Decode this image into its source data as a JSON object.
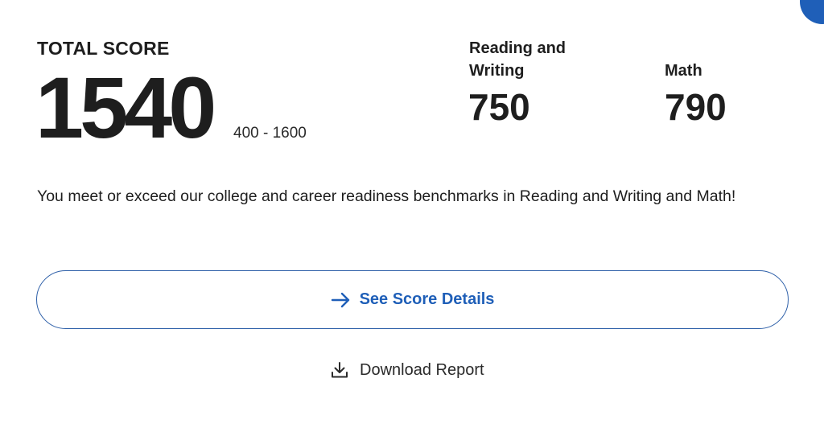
{
  "colors": {
    "accent": "#1f5fb8",
    "text": "#1e1e1e",
    "button_border": "#2d5fa8"
  },
  "total": {
    "label": "TOTAL SCORE",
    "value": "1540",
    "range": "400 - 1600"
  },
  "sections": {
    "reading_writing": {
      "label": "Reading and Writing",
      "value": "750"
    },
    "math": {
      "label": "Math",
      "value": "790"
    }
  },
  "message": "You meet or exceed our college and career readiness benchmarks in Reading and Writing and Math!",
  "actions": {
    "score_details": {
      "label": "See Score Details",
      "icon": "arrow-right-icon"
    },
    "download": {
      "label": "Download Report",
      "icon": "download-icon"
    }
  }
}
